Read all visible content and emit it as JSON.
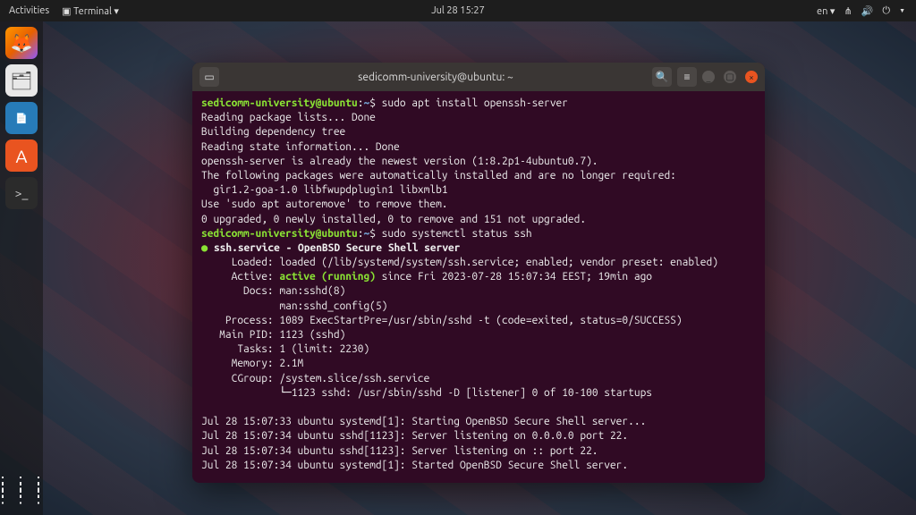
{
  "topbar": {
    "activities": "Activities",
    "app_menu": "Terminal ▾",
    "datetime": "Jul 28  15:27",
    "lang": "en ▾"
  },
  "window": {
    "title": "sedicomm-university@ubuntu: ~"
  },
  "dock": {
    "tooltip_firefox": "Firefox",
    "tooltip_files": "Files",
    "tooltip_writer": "LibreOffice Writer",
    "tooltip_software": "Ubuntu Software",
    "tooltip_terminal": "Terminal"
  },
  "term": {
    "prompt_user": "sedicomm-university@ubuntu",
    "prompt_sep": ":",
    "prompt_path": "~",
    "prompt_tail": "$ ",
    "cmd1": "sudo apt install openssh-server",
    "l1": "Reading package lists... Done",
    "l2": "Building dependency tree",
    "l3": "Reading state information... Done",
    "l4": "openssh-server is already the newest version (1:8.2p1-4ubuntu0.7).",
    "l5": "The following packages were automatically installed and are no longer required:",
    "l6": "  gir1.2-goa-1.0 libfwupdplugin1 libxmlb1",
    "l7": "Use 'sudo apt autoremove' to remove them.",
    "l8": "0 upgraded, 0 newly installed, 0 to remove and 151 not upgraded.",
    "cmd2": "sudo systemctl status ssh",
    "s_dot": "●",
    "s_name": " ssh.service - OpenBSD Secure Shell server",
    "s_loaded": "     Loaded: loaded (/lib/systemd/system/ssh.service; enabled; vendor preset: enabled)",
    "s_active_l": "     Active: ",
    "s_active_v": "active (running)",
    "s_active_r": " since Fri 2023-07-28 15:07:34 EEST; 19min ago",
    "s_docs1": "       Docs: man:sshd(8)",
    "s_docs2": "             man:sshd_config(5)",
    "s_proc": "    Process: 1089 ExecStartPre=/usr/sbin/sshd -t (code=exited, status=0/SUCCESS)",
    "s_pid": "   Main PID: 1123 (sshd)",
    "s_tasks": "      Tasks: 1 (limit: 2230)",
    "s_mem": "     Memory: 2.1M",
    "s_cgrp": "     CGroup: /system.slice/ssh.service",
    "s_tree": "             └─1123 sshd: /usr/sbin/sshd -D [listener] 0 of 10-100 startups",
    "log1": "Jul 28 15:07:33 ubuntu systemd[1]: Starting OpenBSD Secure Shell server...",
    "log2": "Jul 28 15:07:34 ubuntu sshd[1123]: Server listening on 0.0.0.0 port 22.",
    "log3": "Jul 28 15:07:34 ubuntu sshd[1123]: Server listening on :: port 22.",
    "log4": "Jul 28 15:07:34 ubuntu systemd[1]: Started OpenBSD Secure Shell server."
  }
}
